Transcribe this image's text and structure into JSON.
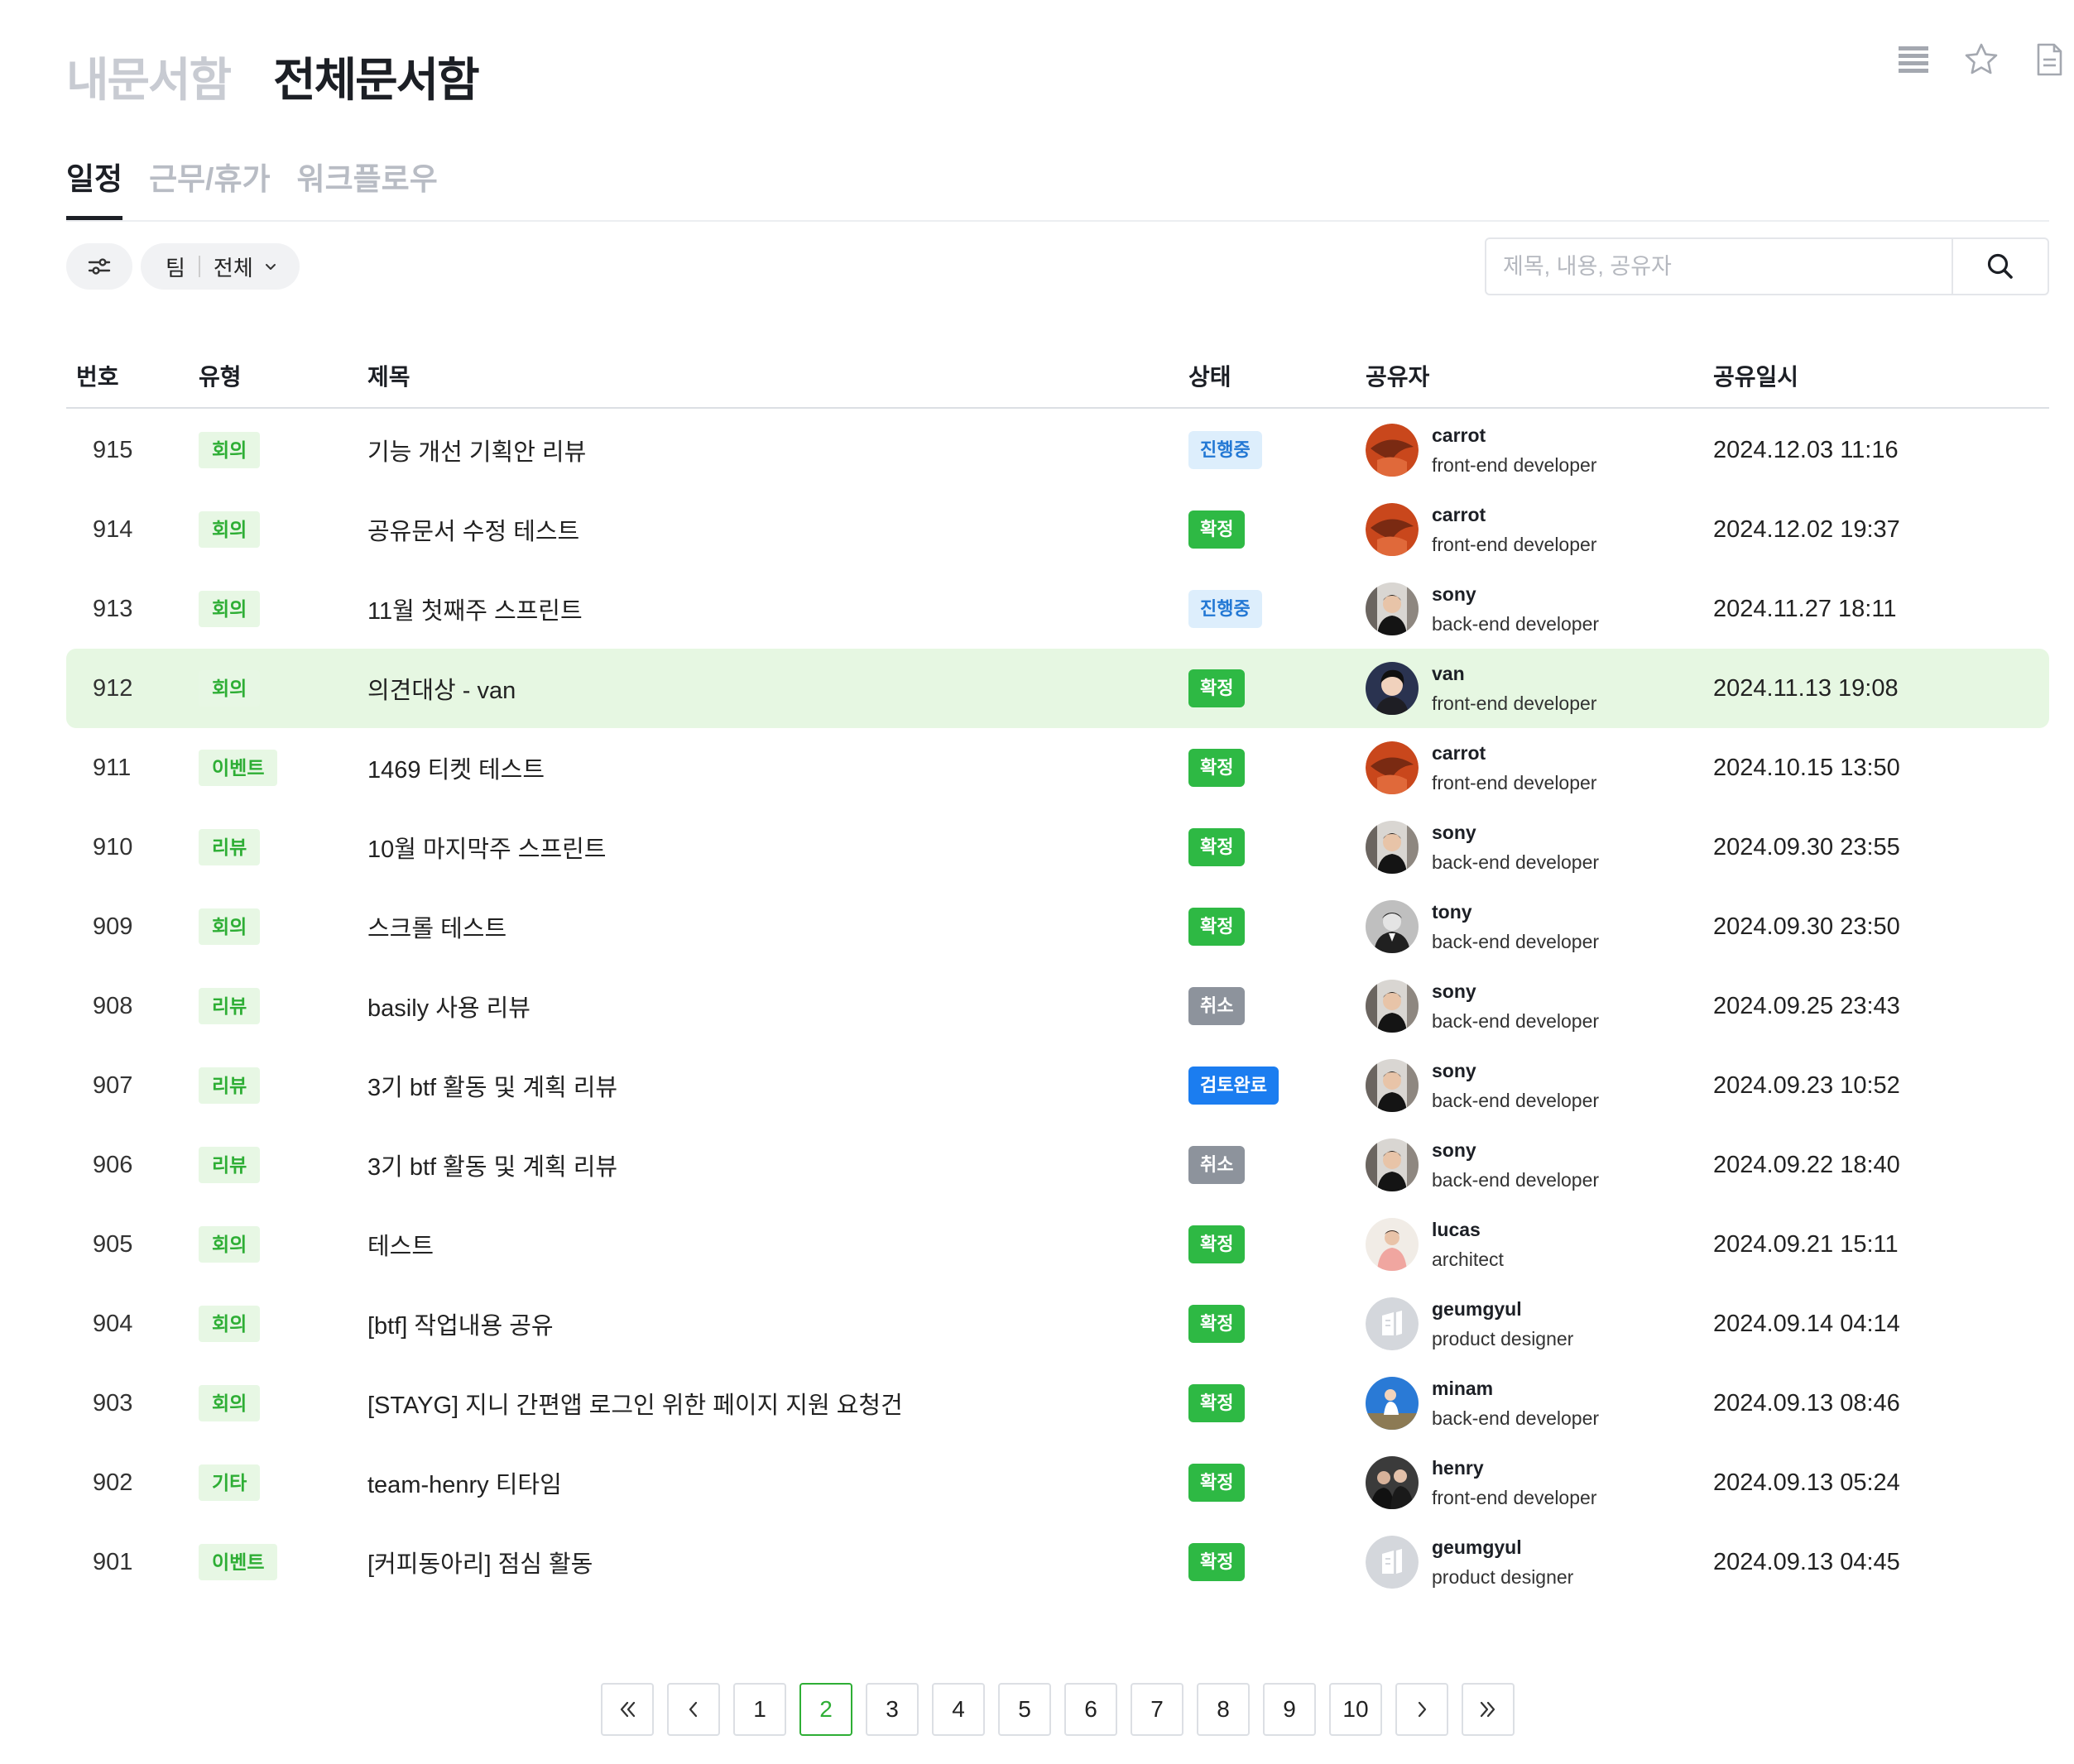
{
  "doc_tabs": [
    {
      "label": "내문서함",
      "active": false
    },
    {
      "label": "전체문서함",
      "active": true
    }
  ],
  "top_icons": [
    "list-view-icon",
    "star-icon",
    "document-icon"
  ],
  "sub_tabs": [
    {
      "label": "일정",
      "active": true
    },
    {
      "label": "근무/휴가",
      "active": false
    },
    {
      "label": "워크플로우",
      "active": false
    }
  ],
  "filters": {
    "team_label": "팀",
    "team_value": "전체"
  },
  "search": {
    "placeholder": "제목, 내용, 공유자"
  },
  "table": {
    "headers": {
      "num": "번호",
      "type": "유형",
      "title": "제목",
      "status": "상태",
      "owner": "공유자",
      "date": "공유일시"
    },
    "rows": [
      {
        "num": "915",
        "type": "회의",
        "title": "기능 개선 기획안 리뷰",
        "status": "진행중",
        "status_kind": "ongoing",
        "owner": "carrot",
        "role": "front-end developer",
        "avatar": "carrot",
        "date": "2024.12.03 11:16",
        "highlight": false
      },
      {
        "num": "914",
        "type": "회의",
        "title": "공유문서 수정 테스트",
        "status": "확정",
        "status_kind": "confirmed",
        "owner": "carrot",
        "role": "front-end developer",
        "avatar": "carrot",
        "date": "2024.12.02 19:37",
        "highlight": false
      },
      {
        "num": "913",
        "type": "회의",
        "title": "11월 첫째주 스프린트",
        "status": "진행중",
        "status_kind": "ongoing",
        "owner": "sony",
        "role": "back-end developer",
        "avatar": "sony",
        "date": "2024.11.27 18:11",
        "highlight": false
      },
      {
        "num": "912",
        "type": "회의",
        "title": "의견대상 - van",
        "status": "확정",
        "status_kind": "confirmed",
        "owner": "van",
        "role": "front-end developer",
        "avatar": "van",
        "date": "2024.11.13 19:08",
        "highlight": true
      },
      {
        "num": "911",
        "type": "이벤트",
        "title": "1469 티켓 테스트",
        "status": "확정",
        "status_kind": "confirmed",
        "owner": "carrot",
        "role": "front-end developer",
        "avatar": "carrot",
        "date": "2024.10.15 13:50",
        "highlight": false
      },
      {
        "num": "910",
        "type": "리뷰",
        "title": "10월 마지막주 스프린트",
        "status": "확정",
        "status_kind": "confirmed",
        "owner": "sony",
        "role": "back-end developer",
        "avatar": "sony",
        "date": "2024.09.30 23:55",
        "highlight": false
      },
      {
        "num": "909",
        "type": "회의",
        "title": "스크롤 테스트",
        "status": "확정",
        "status_kind": "confirmed",
        "owner": "tony",
        "role": "back-end developer",
        "avatar": "tony",
        "date": "2024.09.30 23:50",
        "highlight": false
      },
      {
        "num": "908",
        "type": "리뷰",
        "title": "basily 사용 리뷰",
        "status": "취소",
        "status_kind": "cancel",
        "owner": "sony",
        "role": "back-end developer",
        "avatar": "sony",
        "date": "2024.09.25 23:43",
        "highlight": false
      },
      {
        "num": "907",
        "type": "리뷰",
        "title": "3기 btf 활동 및 계획 리뷰",
        "status": "검토완료",
        "status_kind": "reviewed",
        "owner": "sony",
        "role": "back-end developer",
        "avatar": "sony",
        "date": "2024.09.23 10:52",
        "highlight": false
      },
      {
        "num": "906",
        "type": "리뷰",
        "title": "3기 btf 활동 및 계획 리뷰",
        "status": "취소",
        "status_kind": "cancel",
        "owner": "sony",
        "role": "back-end developer",
        "avatar": "sony",
        "date": "2024.09.22 18:40",
        "highlight": false
      },
      {
        "num": "905",
        "type": "회의",
        "title": "테스트",
        "status": "확정",
        "status_kind": "confirmed",
        "owner": "lucas",
        "role": "architect",
        "avatar": "lucas",
        "date": "2024.09.21 15:11",
        "highlight": false
      },
      {
        "num": "904",
        "type": "회의",
        "title": "[btf] 작업내용 공유",
        "status": "확정",
        "status_kind": "confirmed",
        "owner": "geumgyul",
        "role": "product designer",
        "avatar": "placeholder",
        "date": "2024.09.14 04:14",
        "highlight": false
      },
      {
        "num": "903",
        "type": "회의",
        "title": "[STAYG] 지니 간편앱 로그인 위한 페이지 지원 요청건",
        "status": "확정",
        "status_kind": "confirmed",
        "owner": "minam",
        "role": "back-end developer",
        "avatar": "minam",
        "date": "2024.09.13 08:46",
        "highlight": false
      },
      {
        "num": "902",
        "type": "기타",
        "title": "team-henry 티타임",
        "status": "확정",
        "status_kind": "confirmed",
        "owner": "henry",
        "role": "front-end developer",
        "avatar": "henry",
        "date": "2024.09.13 05:24",
        "highlight": false
      },
      {
        "num": "901",
        "type": "이벤트",
        "title": "[커피동아리] 점심 활동",
        "status": "확정",
        "status_kind": "confirmed",
        "owner": "geumgyul",
        "role": "product designer",
        "avatar": "placeholder",
        "date": "2024.09.13 04:45",
        "highlight": false
      }
    ]
  },
  "pagination": {
    "pages": [
      "1",
      "2",
      "3",
      "4",
      "5",
      "6",
      "7",
      "8",
      "9",
      "10"
    ],
    "current": "2"
  },
  "colors": {
    "accent_green": "#2eae35",
    "confirmed_bg": "#2eb944",
    "ongoing_bg": "#ddeefc",
    "ongoing_text": "#2378d4",
    "cancel_bg": "#8d939c",
    "reviewed_bg": "#1b7df0",
    "highlight_row": "#e6f7e2"
  }
}
